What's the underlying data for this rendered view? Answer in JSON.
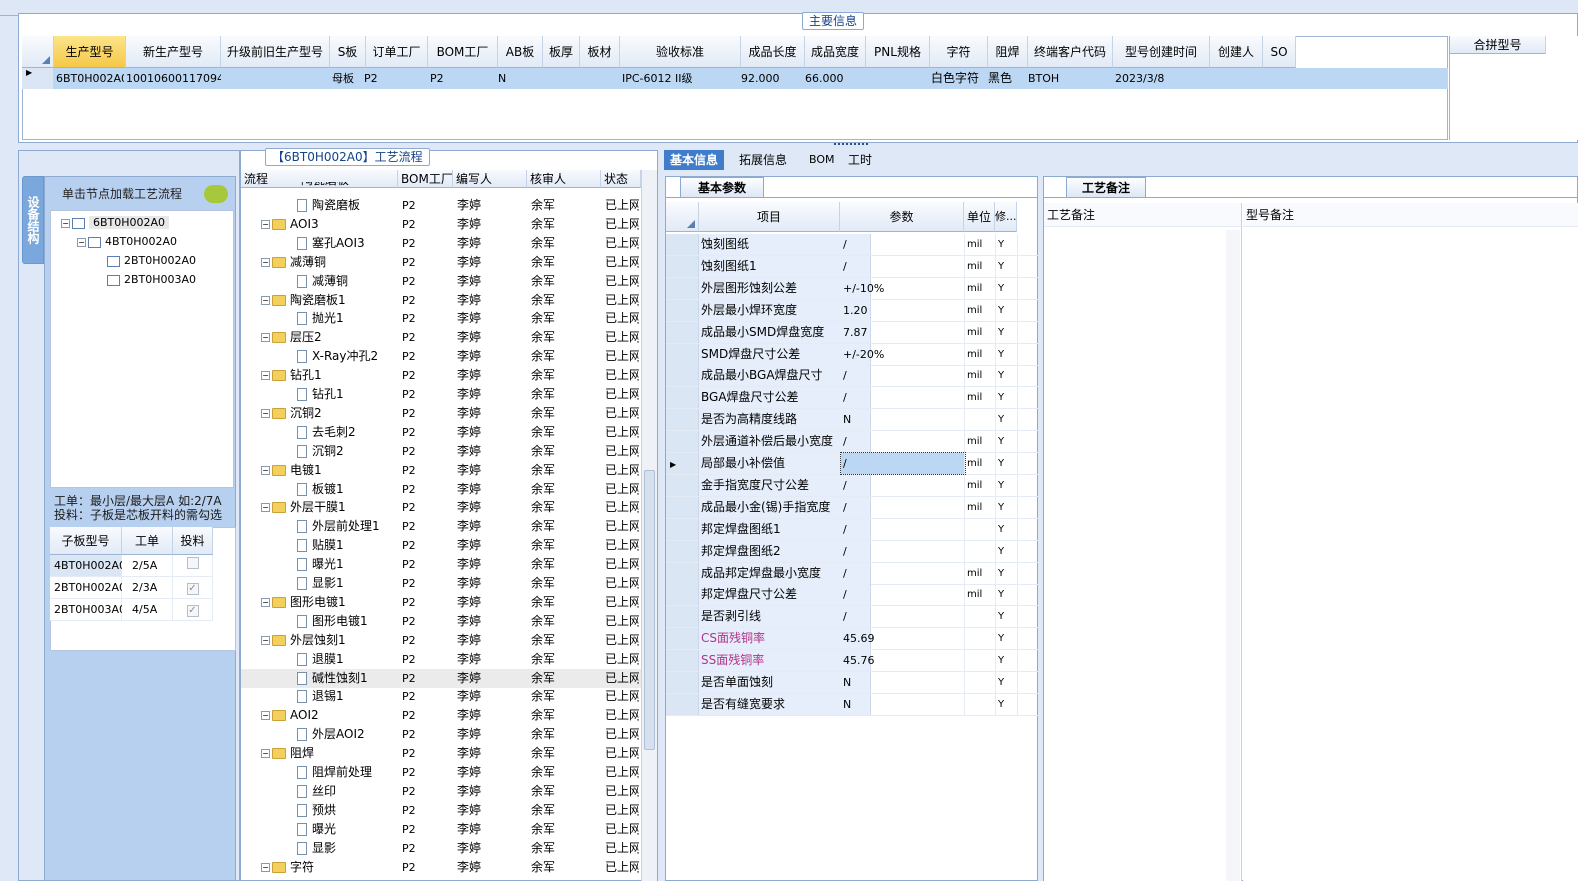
{
  "main_info": {
    "caption": "主要信息",
    "columns": [
      "生产型号",
      "新生产型号",
      "升级前旧生产型号",
      "S板",
      "订单工厂",
      "BOM工厂",
      "AB板",
      "板厚",
      "板材",
      "验收标准",
      "成品长度",
      "成品宽度",
      "PNL规格",
      "字符",
      "阻焊",
      "终端客户代码",
      "型号创建时间",
      "创建人",
      "SO"
    ],
    "extra_column": "合拼型号",
    "row": {
      "production_model": "6BT0H002A0",
      "new_production_model": "10010600117094",
      "s_board": "母板",
      "order_factory": "P2",
      "bom_factory": "P2",
      "ab_board": "N",
      "acceptance_standard": "IPC-6012 II级",
      "length": "92.000",
      "width": "66.000",
      "char": "白色字符",
      "solder_mask": "黑色",
      "customer_code": "BTOH",
      "created_time": "2023/3/8"
    }
  },
  "left": {
    "vertical_tab": "设备结构",
    "header": "单击节点加载工艺流程",
    "tree": [
      "6BT0H002A0",
      "4BT0H002A0",
      "2BT0H002A0",
      "2BT0H003A0"
    ],
    "note_line1": "工单：最小层/最大层A 如:2/7A",
    "note_line2": "投料：子板是芯板开料的需勾选",
    "sub_table": {
      "columns": [
        "子板型号",
        "工单",
        "投料"
      ],
      "rows": [
        {
          "model": "4BT0H002A0",
          "order": "2/5A",
          "checked": "false"
        },
        {
          "model": "2BT0H002A0",
          "order": "2/3A",
          "checked": "true"
        },
        {
          "model": "2BT0H003A0",
          "order": "4/5A",
          "checked": "true"
        }
      ]
    }
  },
  "flow": {
    "caption": "【6BT0H002A0】工艺流程",
    "columns": [
      "流程",
      "BOM工厂",
      "编写人",
      "核审人",
      "状态"
    ],
    "top_partial": "陶瓷磨板",
    "rows": [
      {
        "name": "陶瓷磨板",
        "kind": "doc"
      },
      {
        "name": "AOI3",
        "kind": "folder"
      },
      {
        "name": "塞孔AOI3",
        "kind": "doc"
      },
      {
        "name": "减薄铜",
        "kind": "folder"
      },
      {
        "name": "减薄铜",
        "kind": "doc"
      },
      {
        "name": "陶瓷磨板1",
        "kind": "folder"
      },
      {
        "name": "抛光1",
        "kind": "doc"
      },
      {
        "name": "层压2",
        "kind": "folder"
      },
      {
        "name": "X-Ray冲孔2",
        "kind": "doc"
      },
      {
        "name": "钻孔1",
        "kind": "folder"
      },
      {
        "name": "钻孔1",
        "kind": "doc"
      },
      {
        "name": "沉铜2",
        "kind": "folder"
      },
      {
        "name": "去毛刺2",
        "kind": "doc"
      },
      {
        "name": "沉铜2",
        "kind": "doc"
      },
      {
        "name": "电镀1",
        "kind": "folder"
      },
      {
        "name": "板镀1",
        "kind": "doc"
      },
      {
        "name": "外层干膜1",
        "kind": "folder"
      },
      {
        "name": "外层前处理1",
        "kind": "doc"
      },
      {
        "name": "贴膜1",
        "kind": "doc"
      },
      {
        "name": "曝光1",
        "kind": "doc"
      },
      {
        "name": "显影1",
        "kind": "doc"
      },
      {
        "name": "图形电镀1",
        "kind": "folder"
      },
      {
        "name": "图形电镀1",
        "kind": "doc"
      },
      {
        "name": "外层蚀刻1",
        "kind": "folder"
      },
      {
        "name": "退膜1",
        "kind": "doc"
      },
      {
        "name": "碱性蚀刻1",
        "kind": "doc"
      },
      {
        "name": "退锡1",
        "kind": "doc"
      },
      {
        "name": "AOI2",
        "kind": "folder"
      },
      {
        "name": "外层AOI2",
        "kind": "doc"
      },
      {
        "name": "阻焊",
        "kind": "folder"
      },
      {
        "name": "阻焊前处理",
        "kind": "doc"
      },
      {
        "name": "丝印",
        "kind": "doc"
      },
      {
        "name": "预烘",
        "kind": "doc"
      },
      {
        "name": "曝光",
        "kind": "doc"
      },
      {
        "name": "显影",
        "kind": "doc"
      },
      {
        "name": "字符",
        "kind": "folder"
      }
    ],
    "factory": "P2",
    "author": "李婷",
    "reviewer": "余军",
    "status": "已上网"
  },
  "tabs": [
    "基本信息",
    "拓展信息",
    "BOM",
    "工时"
  ],
  "params": {
    "tab": "基本参数",
    "columns": [
      "项目",
      "参数",
      "单位",
      "修..."
    ],
    "rows": [
      {
        "k": "蚀刻图纸",
        "v": "/",
        "u": "mil",
        "m": "Y"
      },
      {
        "k": "蚀刻图纸1",
        "v": "/",
        "u": "mil",
        "m": "Y"
      },
      {
        "k": "外层图形蚀刻公差",
        "v": "+/-10%",
        "u": "mil",
        "m": "Y"
      },
      {
        "k": "外层最小焊环宽度",
        "v": "1.20",
        "u": "mil",
        "m": "Y"
      },
      {
        "k": "成品最小SMD焊盘宽度",
        "v": "7.87",
        "u": "mil",
        "m": "Y"
      },
      {
        "k": "SMD焊盘尺寸公差",
        "v": "+/-20%",
        "u": "mil",
        "m": "Y"
      },
      {
        "k": "成品最小BGA焊盘尺寸",
        "v": "/",
        "u": "mil",
        "m": "Y"
      },
      {
        "k": "BGA焊盘尺寸公差",
        "v": "/",
        "u": "mil",
        "m": "Y"
      },
      {
        "k": "是否为高精度线路",
        "v": "N",
        "u": "",
        "m": "Y"
      },
      {
        "k": "外层通道补偿后最小宽度",
        "v": "/",
        "u": "mil",
        "m": "Y"
      },
      {
        "k": "局部最小补偿值",
        "v": "/",
        "u": "mil",
        "m": "Y"
      },
      {
        "k": "金手指宽度尺寸公差",
        "v": "/",
        "u": "mil",
        "m": "Y"
      },
      {
        "k": "成品最小金(锡)手指宽度",
        "v": "/",
        "u": "mil",
        "m": "Y"
      },
      {
        "k": "邦定焊盘图纸1",
        "v": "/",
        "u": "",
        "m": "Y"
      },
      {
        "k": "邦定焊盘图纸2",
        "v": "/",
        "u": "",
        "m": "Y"
      },
      {
        "k": "成品邦定焊盘最小宽度",
        "v": "/",
        "u": "mil",
        "m": "Y"
      },
      {
        "k": "邦定焊盘尺寸公差",
        "v": "/",
        "u": "mil",
        "m": "Y"
      },
      {
        "k": "是否剥引线",
        "v": "/",
        "u": "",
        "m": "Y"
      },
      {
        "k": "CS面残铜率",
        "v": "45.69",
        "u": "",
        "m": "Y",
        "pink": "true"
      },
      {
        "k": "SS面残铜率",
        "v": "45.76",
        "u": "",
        "m": "Y",
        "pink": "true"
      },
      {
        "k": "是否单面蚀刻",
        "v": "N",
        "u": "",
        "m": "Y"
      },
      {
        "k": "是否有缝宽要求",
        "v": "N",
        "u": "",
        "m": "Y"
      }
    ]
  },
  "notes": {
    "tab": "工艺备注",
    "col1": "工艺备注",
    "col2": "型号备注"
  },
  "colors": {
    "selected_header": "#f6c847",
    "selected_row": "#bcd7f4",
    "panel_blue": "#b8d0ef",
    "pink_text": "#b2338a"
  }
}
